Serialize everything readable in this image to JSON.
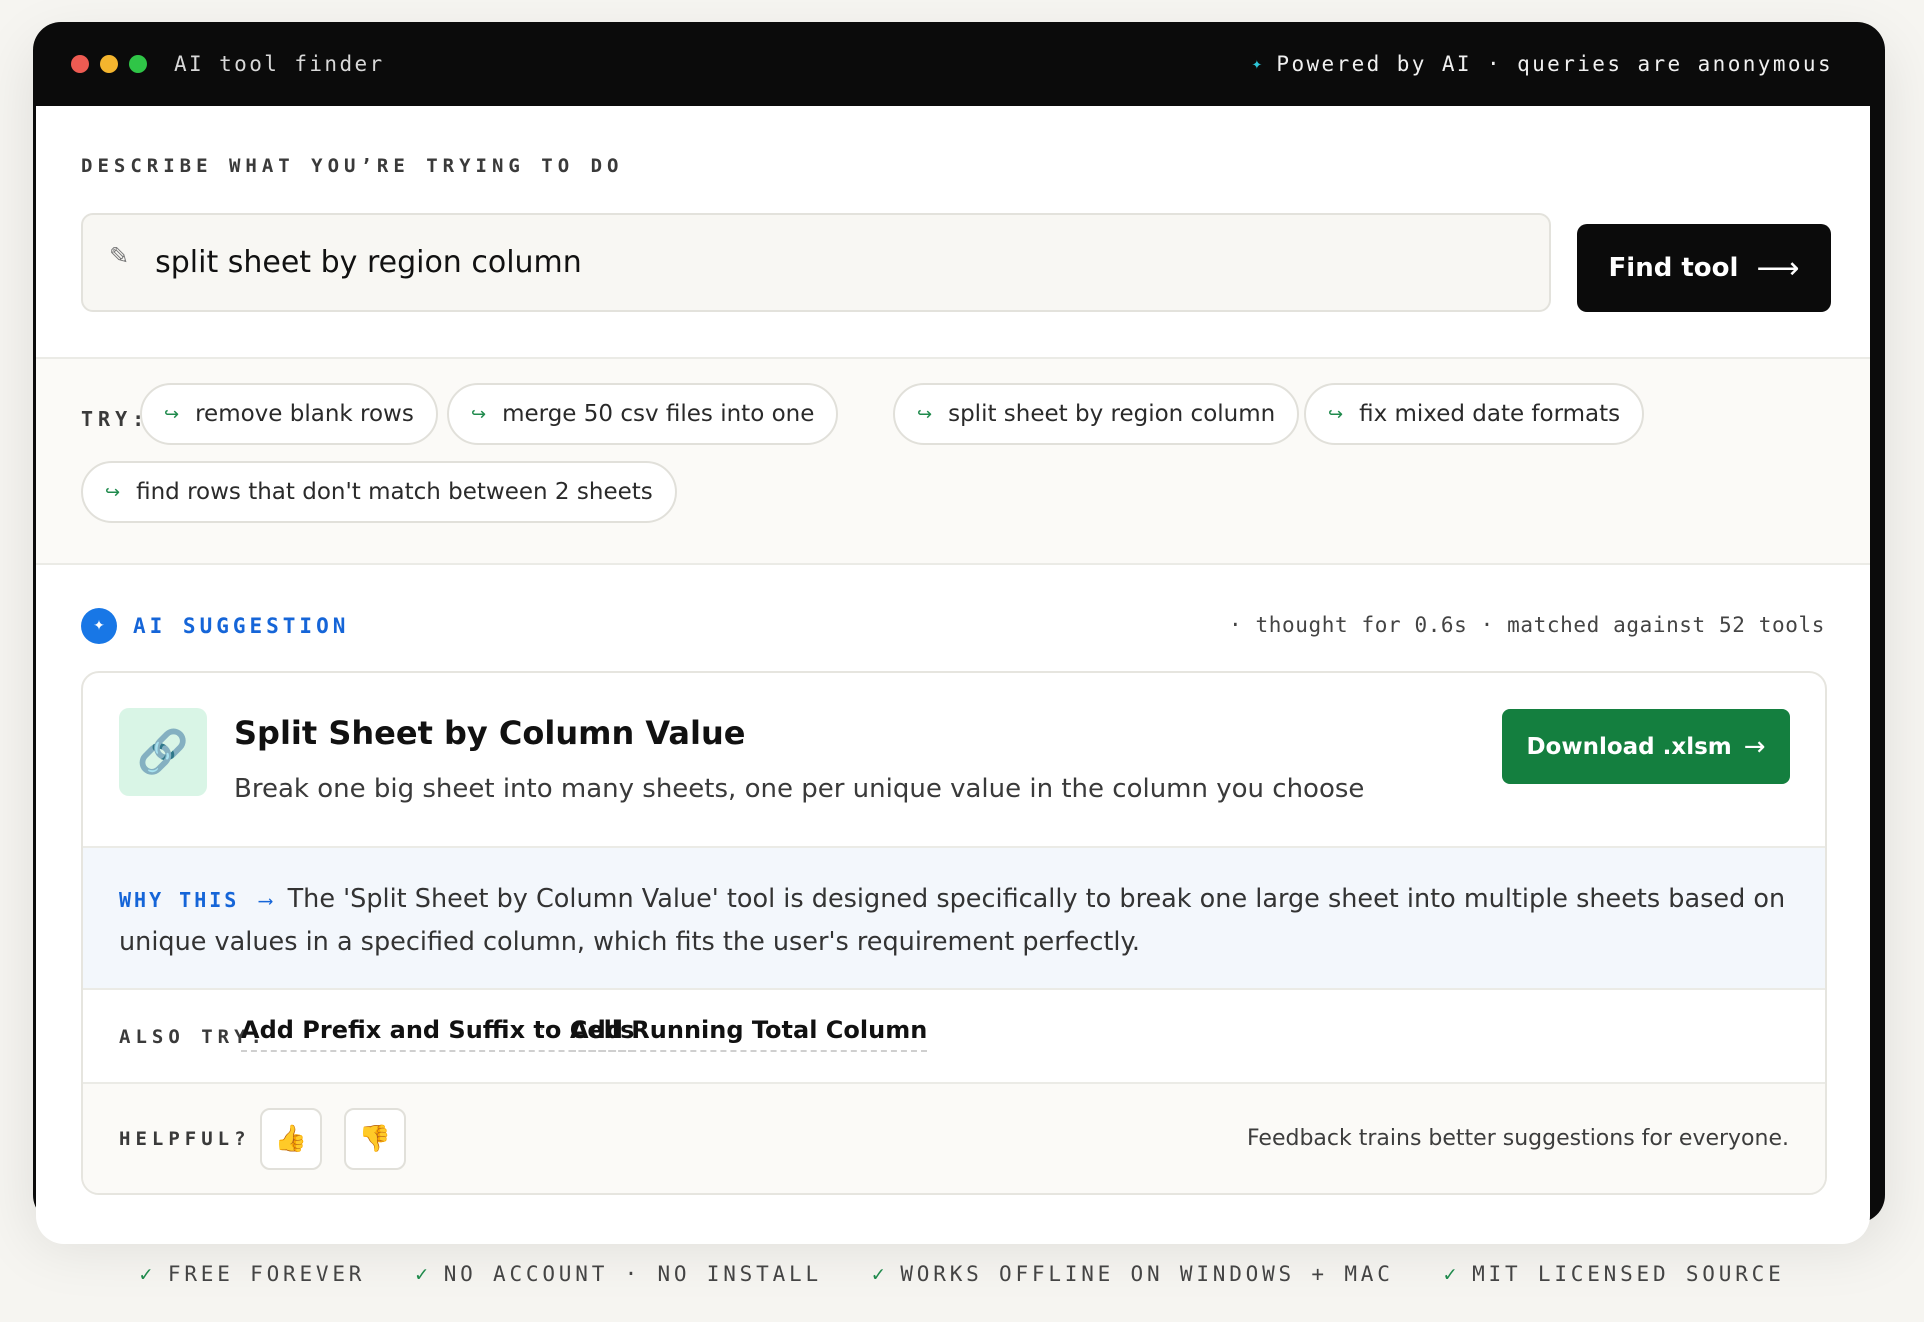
{
  "window": {
    "title": "AI tool finder",
    "status_sparkle": "✦",
    "status_text": "Powered by AI · queries are anonymous"
  },
  "describe": {
    "label": "DESCRIBE WHAT YOU’RE TRYING TO DO",
    "query_value": "split sheet by region column",
    "find_button": "Find tool",
    "find_arrow": "⟶"
  },
  "try": {
    "label": "TRY:",
    "chips": [
      "remove blank rows",
      "merge 50 csv files into one",
      "split sheet by region column",
      "fix mixed date formats",
      "find rows that don't match between 2 sheets"
    ]
  },
  "suggestion": {
    "label": "AI SUGGESTION",
    "meta": "· thought for 0.6s · matched against 52 tools",
    "tool_title": "Split Sheet by Column Value",
    "tool_desc": "Break one big sheet into many sheets, one per unique value in the column you choose",
    "download_button": "Download .xlsm",
    "download_arrow": "→",
    "why_label": "WHY THIS",
    "why_arrow": "⟶",
    "why_text": "The 'Split Sheet by Column Value' tool is designed specifically to break one large sheet into multiple sheets based on unique values in a specified column, which fits the user's requirement perfectly.",
    "also_label": "ALSO TRY:",
    "also_links": [
      "Add Prefix and Suffix to Cells",
      "Add Running Total Column"
    ],
    "helpful_label": "HELPFUL?",
    "feedback_note": "Feedback trains better suggestions for everyone."
  },
  "footer": {
    "items": [
      "FREE FOREVER",
      "NO ACCOUNT · NO INSTALL",
      "WORKS OFFLINE ON WINDOWS + MAC",
      "MIT LICENSED SOURCE"
    ]
  },
  "icons": {
    "tool_icon": "link-icon",
    "pencil": "pencil-icon",
    "thumbs_up": "thumbs-up-icon",
    "thumbs_down": "thumbs-down-icon"
  },
  "colors": {
    "accent_blue": "#1565d8",
    "download_green": "#147f3f",
    "tool_icon_bg": "#d9f5e6"
  }
}
